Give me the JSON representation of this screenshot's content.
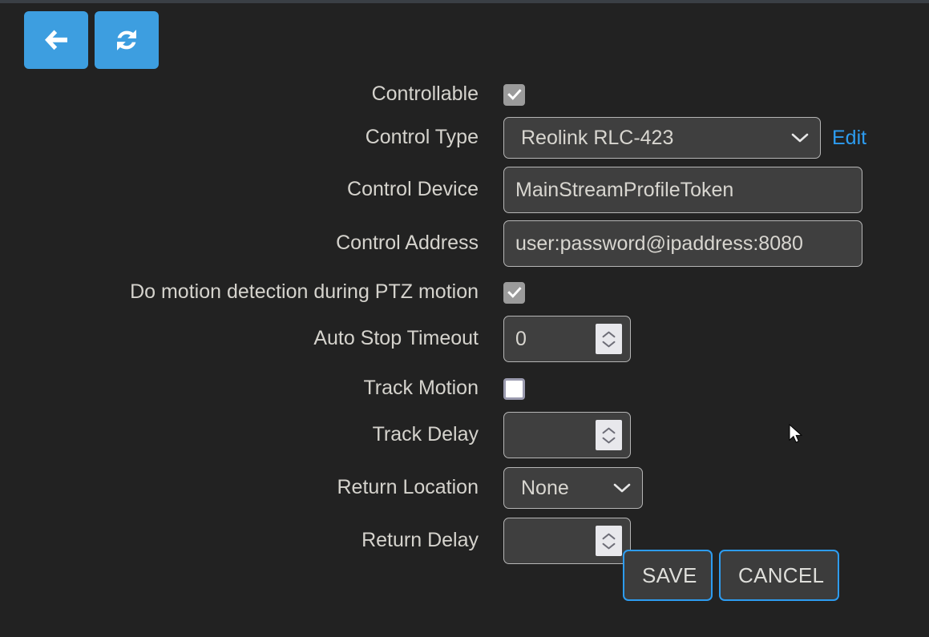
{
  "toolbar": {
    "back_button": {
      "name": "Back",
      "icon": "arrow-left-icon"
    },
    "refresh_button": {
      "name": "Refresh",
      "icon": "refresh-icon"
    }
  },
  "form": {
    "controllable": {
      "label": "Controllable",
      "checked": true
    },
    "control_type": {
      "label": "Control Type",
      "value": "Reolink RLC-423",
      "edit_link": "Edit"
    },
    "control_device": {
      "label": "Control Device",
      "value": "MainStreamProfileToken"
    },
    "control_address": {
      "label": "Control Address",
      "value": "user:password@ipaddress:8080"
    },
    "ptz_motion_detection": {
      "label": "Do motion detection during PTZ motion",
      "checked": true
    },
    "auto_stop_timeout": {
      "label": "Auto Stop Timeout",
      "value": "0"
    },
    "track_motion": {
      "label": "Track Motion",
      "checked": false
    },
    "track_delay": {
      "label": "Track Delay",
      "value": ""
    },
    "return_location": {
      "label": "Return Location",
      "value": "None"
    },
    "return_delay": {
      "label": "Return Delay",
      "value": ""
    }
  },
  "actions": {
    "save_label": "SAVE",
    "cancel_label": "CANCEL"
  },
  "colors": {
    "background": "#222222",
    "accent_blue": "#3d9ee0",
    "link_blue": "#2d9cf0",
    "field_background": "#3f3f3f",
    "field_border": "#b6b6b6",
    "text": "#d8d6d0"
  }
}
